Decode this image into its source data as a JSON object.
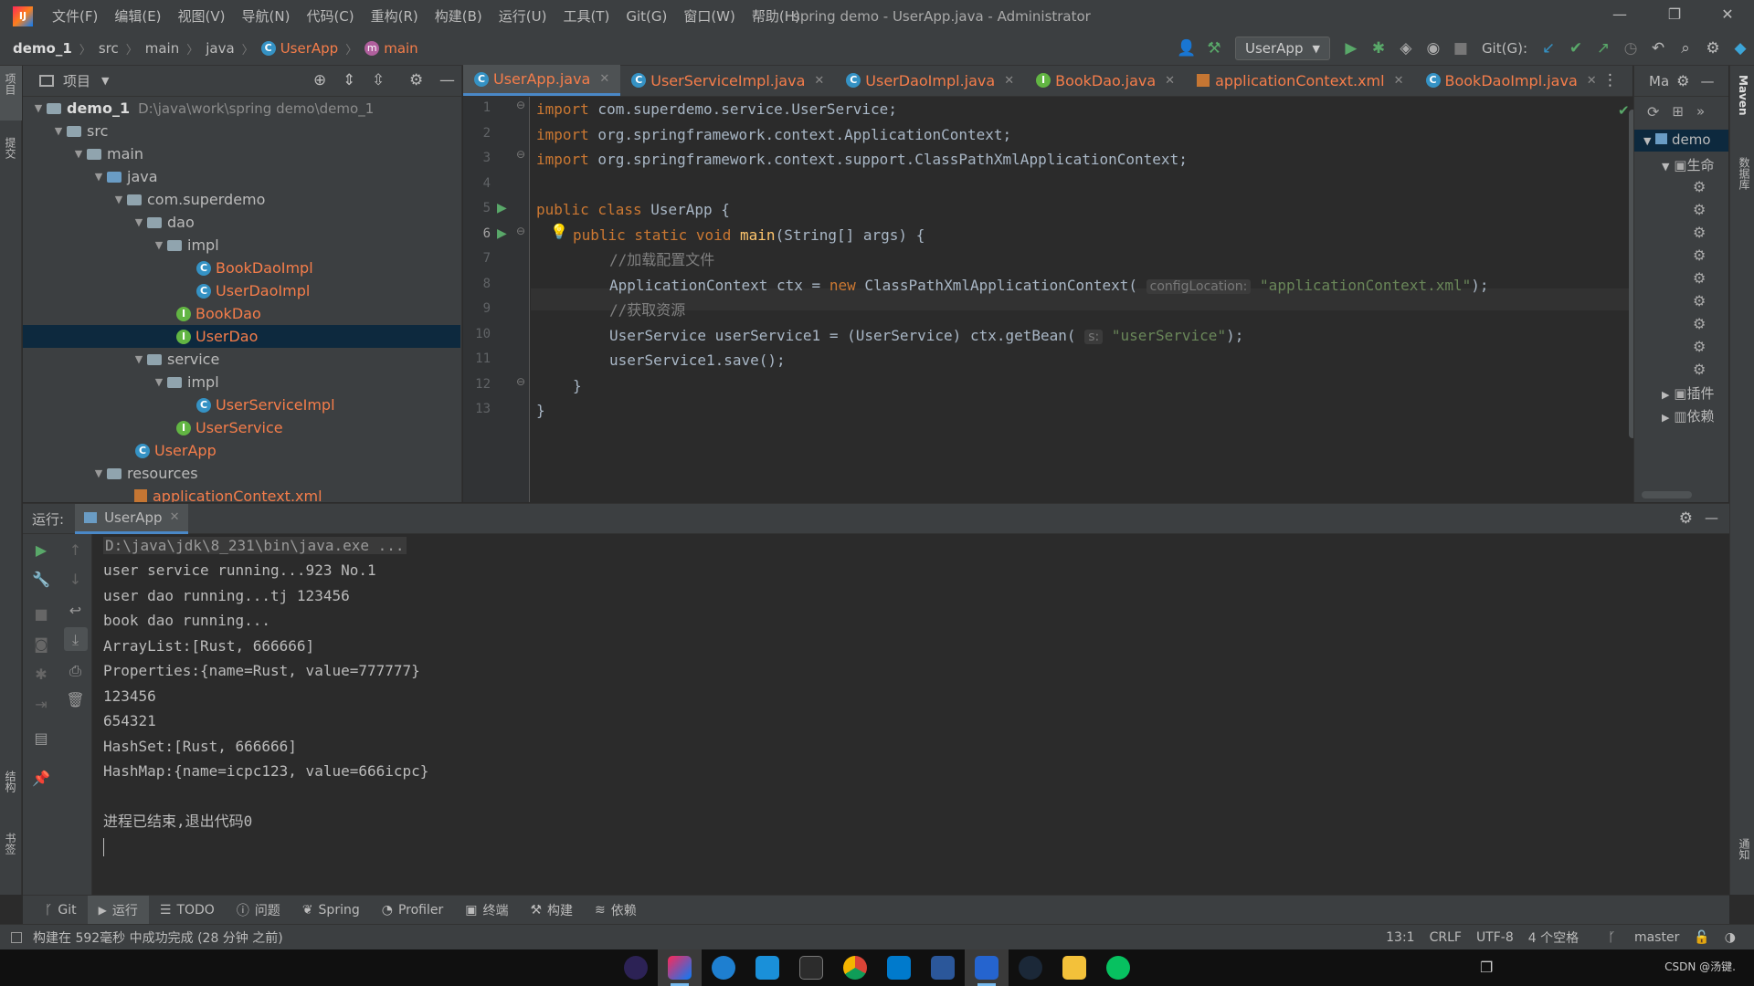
{
  "titlebar": {
    "menus": [
      "文件(F)",
      "编辑(E)",
      "视图(V)",
      "导航(N)",
      "代码(C)",
      "重构(R)",
      "构建(B)",
      "运行(U)",
      "工具(T)",
      "Git(G)",
      "窗口(W)",
      "帮助(H)"
    ],
    "window_title": "spring demo - UserApp.java - Administrator"
  },
  "navbar": {
    "crumbs": [
      "demo_1",
      "src",
      "main",
      "java",
      "UserApp",
      "main"
    ],
    "run_config": "UserApp",
    "git_label": "Git(G):"
  },
  "project": {
    "header": "项目",
    "tree": [
      {
        "label": "demo_1",
        "path": "D:\\java\\work\\spring demo\\demo_1"
      },
      {
        "label": "src"
      },
      {
        "label": "main"
      },
      {
        "label": "java"
      },
      {
        "label": "com.superdemo"
      },
      {
        "label": "dao"
      },
      {
        "label": "impl"
      },
      {
        "label": "BookDaoImpl"
      },
      {
        "label": "UserDaoImpl"
      },
      {
        "label": "BookDao"
      },
      {
        "label": "UserDao"
      },
      {
        "label": "service"
      },
      {
        "label": "impl"
      },
      {
        "label": "UserServiceImpl"
      },
      {
        "label": "UserService"
      },
      {
        "label": "UserApp"
      },
      {
        "label": "resources"
      },
      {
        "label": "applicationContext.xml"
      }
    ]
  },
  "left_strip": {
    "project": "项目",
    "commit": "提交",
    "structure": "结构",
    "bookmarks": "书签"
  },
  "editor": {
    "tabs": [
      "UserApp.java",
      "UserServiceImpl.java",
      "UserDaoImpl.java",
      "BookDao.java",
      "applicationContext.xml",
      "BookDaoImpl.java"
    ],
    "line_numbers": [
      "1",
      "2",
      "3",
      "4",
      "5",
      "6",
      "7",
      "8",
      "9",
      "10",
      "11",
      "12",
      "13"
    ],
    "code": {
      "l1_kw": "import",
      "l1_rest": " com.superdemo.service.UserService;",
      "l2_kw": "import",
      "l2_rest": " org.springframework.context.ApplicationContext;",
      "l3_kw": "import",
      "l3_rest": " org.springframework.context.support.ClassPathXmlApplicationContext;",
      "l5_kw": "public class",
      "l5_rest": " UserApp {",
      "l6_kw": "public static void",
      "l6_fn": "main",
      "l6_rest": "(String[] args) {",
      "l7_cm": "//加载配置文件",
      "l8_a": "ApplicationContext ctx = ",
      "l8_kw": "new",
      "l8_b": " ClassPathXmlApplicationContext(",
      "l8_hint": "configLocation:",
      "l8_str": "\"applicationContext.xml\"",
      "l8_c": ");",
      "l9_cm": "//获取资源",
      "l10_a": "UserService userService1 = (UserService) ctx.getBean(",
      "l10_hint": "s:",
      "l10_str": "\"userService\"",
      "l10_c": ");",
      "l11": "userService1.save();",
      "l12": "}",
      "l13": "}"
    }
  },
  "maven": {
    "title": "Ma",
    "root": "demo",
    "lifecycle": "生命",
    "plugins": "插件",
    "deps": "依赖"
  },
  "right_strip": {
    "maven": "Maven",
    "database": "数据库",
    "notifications": "通知"
  },
  "run": {
    "label": "运行:",
    "tab": "UserApp",
    "output": [
      "D:\\java\\jdk\\8_231\\bin\\java.exe ...",
      "user service running...923 No.1",
      "user dao running...tj 123456",
      "book dao running...",
      "ArrayList:[Rust, 666666]",
      "Properties:{name=Rust, value=777777}",
      "123456",
      "654321",
      "HashSet:[Rust, 666666]",
      "HashMap:{name=icpc123, value=666icpc}",
      "",
      "进程已结束,退出代码0"
    ]
  },
  "bottom_tabs": [
    "Git",
    "运行",
    "TODO",
    "问题",
    "Spring",
    "Profiler",
    "终端",
    "构建",
    "依赖"
  ],
  "status": {
    "message": "构建在 592毫秒 中成功完成 (28 分钟 之前)",
    "position": "13:1",
    "line_sep": "CRLF",
    "encoding": "UTF-8",
    "indent": "4 个空格",
    "branch": "master"
  },
  "taskbar": {
    "tray_text": "CSDN @汤键."
  },
  "colors": {
    "accent": "#4a88c7",
    "selection": "#0d293e",
    "keyword": "#cc7832",
    "string": "#6a8759",
    "function": "#ffc66d",
    "modified_file": "#f57d4a"
  }
}
